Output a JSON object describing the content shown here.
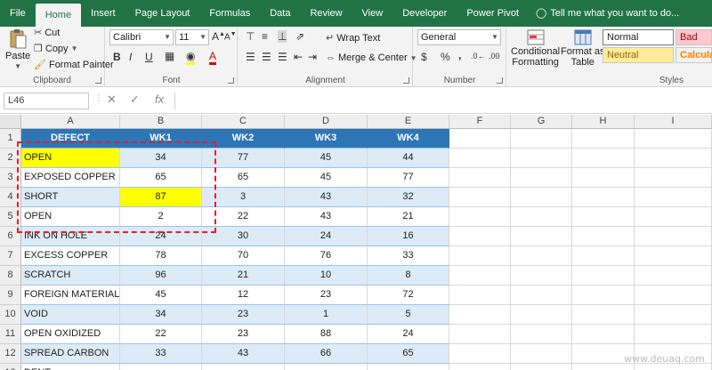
{
  "tabs": [
    "File",
    "Home",
    "Insert",
    "Page Layout",
    "Formulas",
    "Data",
    "Review",
    "View",
    "Developer",
    "Power Pivot"
  ],
  "active_tab": "Home",
  "tell_me": "Tell me what you want to do...",
  "ribbon": {
    "clipboard": {
      "paste": "Paste",
      "cut": "Cut",
      "copy": "Copy",
      "format_painter": "Format Painter",
      "label": "Clipboard"
    },
    "font": {
      "family": "Calibri",
      "size": "11",
      "bold": "B",
      "italic": "I",
      "underline": "U",
      "label": "Font"
    },
    "alignment": {
      "wrap_text": "Wrap Text",
      "merge_center": "Merge & Center",
      "label": "Alignment"
    },
    "number": {
      "format": "General",
      "currency": "$",
      "percent": "%",
      "comma": ",",
      "label": "Number"
    },
    "styles": {
      "conditional_formatting_1": "Conditional",
      "conditional_formatting_2": "Formatting",
      "format_as_table_1": "Format as",
      "format_as_table_2": "Table",
      "normal": "Normal",
      "bad": "Bad",
      "neutral": "Neutral",
      "calculation": "Calcula",
      "label": "Styles"
    }
  },
  "formula_bar": {
    "name_box": "L46",
    "fx": "fx",
    "content": ""
  },
  "columns": [
    "A",
    "B",
    "C",
    "D",
    "E",
    "F",
    "G",
    "H",
    "I"
  ],
  "rows": [
    "1",
    "2",
    "3",
    "4",
    "5",
    "6",
    "7",
    "8",
    "9",
    "10",
    "11",
    "12",
    "13"
  ],
  "table": {
    "headers": [
      "DEFECT",
      "WK1",
      "WK2",
      "WK3",
      "WK4"
    ],
    "data": [
      [
        "OPEN",
        "34",
        "77",
        "45",
        "44"
      ],
      [
        "EXPOSED COPPER",
        "65",
        "65",
        "45",
        "77"
      ],
      [
        "SHORT",
        "87",
        "3",
        "43",
        "32"
      ],
      [
        "OPEN",
        "2",
        "22",
        "43",
        "21"
      ],
      [
        "INK ON HOLE",
        "24",
        "30",
        "24",
        "16"
      ],
      [
        "EXCESS COPPER",
        "78",
        "70",
        "76",
        "33"
      ],
      [
        "SCRATCH",
        "96",
        "21",
        "10",
        "8"
      ],
      [
        "FOREIGN MATERIAL",
        "45",
        "12",
        "23",
        "72"
      ],
      [
        "VOID",
        "34",
        "23",
        "1",
        "5"
      ],
      [
        "OPEN OXIDIZED",
        "22",
        "23",
        "88",
        "24"
      ],
      [
        "SPREAD CARBON",
        "33",
        "43",
        "66",
        "65"
      ],
      [
        "DENT",
        "",
        "",
        "",
        ""
      ]
    ]
  },
  "highlight_color": "#ffff00",
  "header_color": "#2e75b6",
  "band_color": "#ddebf7",
  "selection_color": "#e0202a",
  "watermark": "www.deuaq.com"
}
